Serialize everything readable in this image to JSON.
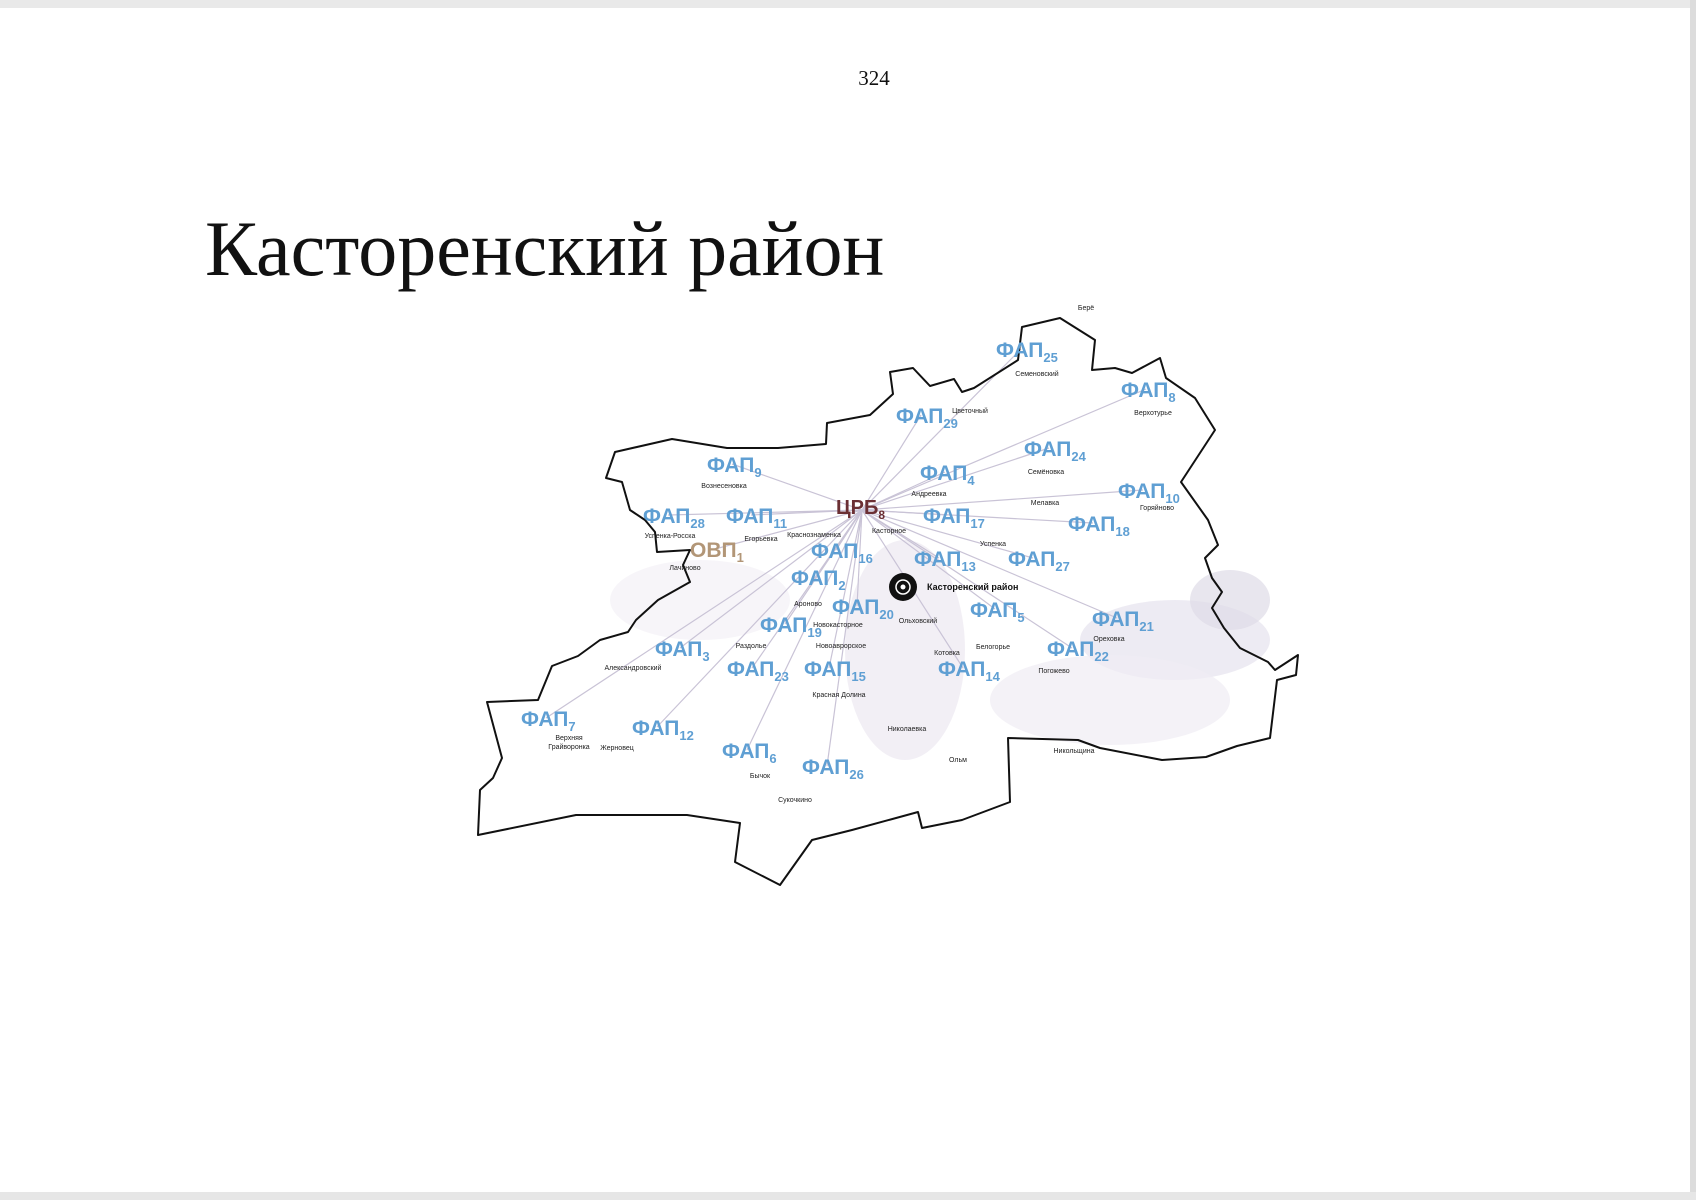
{
  "page_number": "324",
  "title": "Касторенский район",
  "district_center": {
    "label": "Касторенский район"
  },
  "facilities": [
    {
      "id": "fap25",
      "label": "ФАП",
      "sub": "25",
      "type": "fap",
      "village": "Семеновский"
    },
    {
      "id": "fap8",
      "label": "ФАП",
      "sub": "8",
      "type": "fap",
      "village": "Верхотурье"
    },
    {
      "id": "fap29",
      "label": "ФАП",
      "sub": "29",
      "type": "fap",
      "village": "Цветочный"
    },
    {
      "id": "fap24",
      "label": "ФАП",
      "sub": "24",
      "type": "fap",
      "village": "Семёновка"
    },
    {
      "id": "fap9",
      "label": "ФАП",
      "sub": "9",
      "type": "fap",
      "village": "Вознесеновка"
    },
    {
      "id": "fap4",
      "label": "ФАП",
      "sub": "4",
      "type": "fap",
      "village": "Андреевка"
    },
    {
      "id": "fap10",
      "label": "ФАП",
      "sub": "10",
      "type": "fap",
      "village": "Горяйново"
    },
    {
      "id": "crb8",
      "label": "ЦРБ",
      "sub": "8",
      "type": "crb",
      "village": "Касторное"
    },
    {
      "id": "fap28",
      "label": "ФАП",
      "sub": "28",
      "type": "fap",
      "village": "Успенка-Росска"
    },
    {
      "id": "fap11",
      "label": "ФАП",
      "sub": "11",
      "type": "fap",
      "village": "Егорьевка"
    },
    {
      "id": "fap17",
      "label": "ФАП",
      "sub": "17",
      "type": "fap",
      "village": "Успенка"
    },
    {
      "id": "fap18",
      "label": "ФАП",
      "sub": "18",
      "type": "fap",
      "village": "Мелавка"
    },
    {
      "id": "ovp1",
      "label": "ОВП",
      "sub": "1",
      "type": "ovp",
      "village": "Лачиново"
    },
    {
      "id": "fap16",
      "label": "ФАП",
      "sub": "16",
      "type": "fap",
      "village": "Краснознаменка"
    },
    {
      "id": "fap13",
      "label": "ФАП",
      "sub": "13",
      "type": "fap",
      "village": ""
    },
    {
      "id": "fap27",
      "label": "ФАП",
      "sub": "27",
      "type": "fap",
      "village": ""
    },
    {
      "id": "fap2",
      "label": "ФАП",
      "sub": "2",
      "type": "fap",
      "village": "Ароново"
    },
    {
      "id": "fap20",
      "label": "ФАП",
      "sub": "20",
      "type": "fap",
      "village": "Новокасторное"
    },
    {
      "id": "fap5",
      "label": "ФАП",
      "sub": "5",
      "type": "fap",
      "village": "Ольховский"
    },
    {
      "id": "fap21",
      "label": "ФАП",
      "sub": "21",
      "type": "fap",
      "village": "Ореховка"
    },
    {
      "id": "fap19",
      "label": "ФАП",
      "sub": "19",
      "type": "fap",
      "village": "Раздолье"
    },
    {
      "id": "fap3",
      "label": "ФАП",
      "sub": "3",
      "type": "fap",
      "village": "Александровский"
    },
    {
      "id": "fap22",
      "label": "ФАП",
      "sub": "22",
      "type": "fap",
      "village": "Погожево"
    },
    {
      "id": "fap23",
      "label": "ФАП",
      "sub": "23",
      "type": "fap",
      "village": "Новоаврорское"
    },
    {
      "id": "fap15",
      "label": "ФАП",
      "sub": "15",
      "type": "fap",
      "village": "Красная Долина"
    },
    {
      "id": "fap14",
      "label": "ФАП",
      "sub": "14",
      "type": "fap",
      "village": "Котовка"
    },
    {
      "id": "fap7",
      "label": "ФАП",
      "sub": "7",
      "type": "fap",
      "village": "Верхняя Грайворонка"
    },
    {
      "id": "fap12",
      "label": "ФАП",
      "sub": "12",
      "type": "fap",
      "village": "Жерновец"
    },
    {
      "id": "fap6",
      "label": "ФАП",
      "sub": "6",
      "type": "fap",
      "village": "Бычок"
    },
    {
      "id": "fap26",
      "label": "ФАП",
      "sub": "26",
      "type": "fap",
      "village": "Сукочкино"
    }
  ],
  "extra_villages": [
    "Берё",
    "Белогорье",
    "Николаевка",
    "Ольм",
    "Никольщина"
  ],
  "colors": {
    "fap": "#5f9fd3",
    "crb": "#6b2f33",
    "ovp": "#b29677",
    "border": "#111111",
    "roads": "#c9c3d6"
  }
}
